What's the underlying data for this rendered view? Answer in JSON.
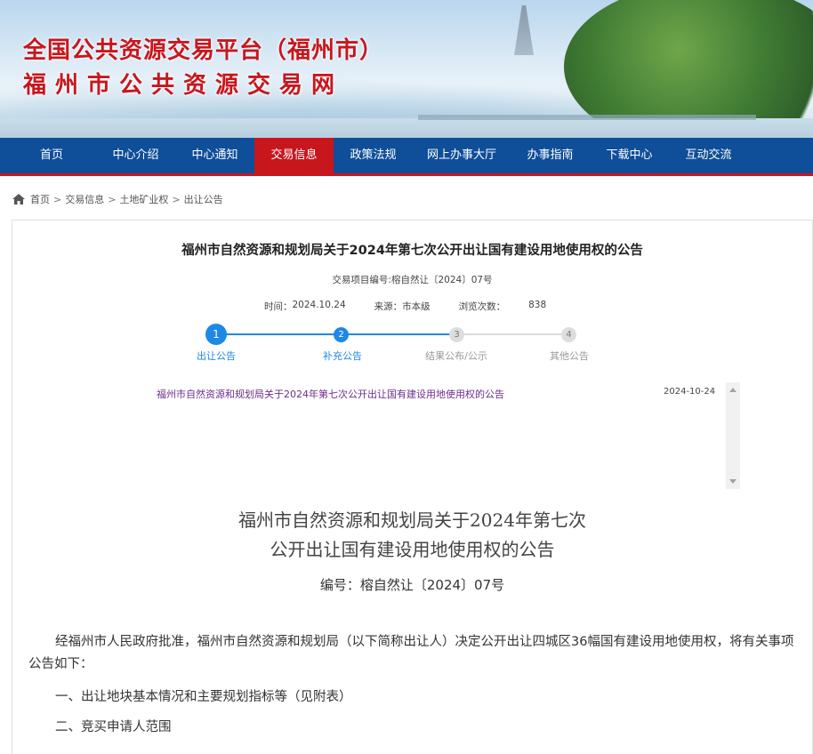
{
  "header": {
    "title": "全国公共资源交易平台（福州市）",
    "subtitle": "福州市公共资源交易网"
  },
  "nav": {
    "items": [
      {
        "label": "首页",
        "active": false
      },
      {
        "label": "中心介绍",
        "active": false
      },
      {
        "label": "中心通知",
        "active": false
      },
      {
        "label": "交易信息",
        "active": true
      },
      {
        "label": "政策法规",
        "active": false
      },
      {
        "label": "网上办事大厅",
        "active": false
      },
      {
        "label": "办事指南",
        "active": false
      },
      {
        "label": "下载中心",
        "active": false
      },
      {
        "label": "互动交流",
        "active": false
      }
    ]
  },
  "breadcrumb": {
    "items": [
      "首页",
      "交易信息",
      "土地矿业权",
      "出让公告"
    ],
    "separator": ">"
  },
  "notice": {
    "title": "福州市自然资源和规划局关于2024年第七次公开出让国有建设用地使用权的公告",
    "project_no": "交易项目编号:榕自然让〔2024〕07号",
    "time_label": "时间：",
    "time": "2024.10.24",
    "source_label": "来源：",
    "source": "市本级",
    "views_label": "浏览次数：",
    "views": "838"
  },
  "steps": [
    {
      "num": "1",
      "label": "出让公告",
      "done": true
    },
    {
      "num": "2",
      "label": "补充公告",
      "done": true
    },
    {
      "num": "3",
      "label": "结果公布/公示",
      "done": false
    },
    {
      "num": "4",
      "label": "其他公告",
      "done": false
    }
  ],
  "list": {
    "items": [
      {
        "title": "福州市自然资源和规划局关于2024年第七次公开出让国有建设用地使用权的公告",
        "date": "2024-10-24"
      }
    ]
  },
  "article": {
    "title_line1": "福州市自然资源和规划局关于2024年第七次",
    "title_line2": "公开出让国有建设用地使用权的公告",
    "number": "编号：榕自然让〔2024〕07号",
    "paragraph1": "经福州市人民政府批准，福州市自然资源和规划局（以下简称出让人）决定公开出让四城区36幅国有建设用地使用权，将有关事项公告如下：",
    "heading1": "一、出让地块基本情况和主要规划指标等（见附表）",
    "heading2": "二、竞买申请人范围"
  },
  "colors": {
    "nav_bg": "#0f4e98",
    "accent_red": "#c8161d",
    "step_active": "#1e88e5",
    "step_inactive": "#dddddd",
    "link_visited": "#6d2d8a"
  }
}
